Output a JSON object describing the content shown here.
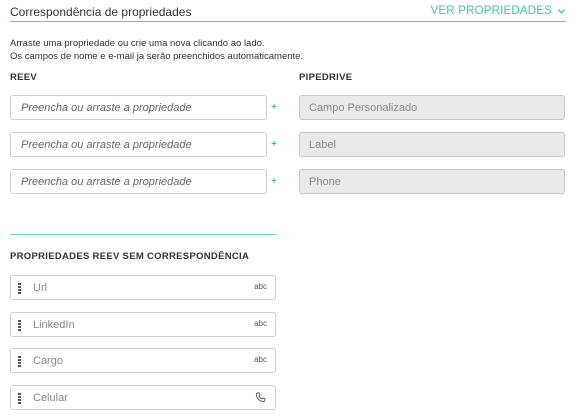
{
  "header": {
    "title": "Correspondência de propriedades",
    "toggle_label": "VER PROPRIEDADES"
  },
  "description": {
    "line1": "Arraste uma propriedade ou crie uma nova clicando ao lado.",
    "line2": "Os campos de nome e e-mail ja serão preenchidos automaticamente."
  },
  "columns": {
    "reev": "REEV",
    "pipedrive": "PIPEDRIVE"
  },
  "mappings": [
    {
      "placeholder": "Preencha ou arraste a propriedade",
      "pipedrive_field": "Campo Personalizado"
    },
    {
      "placeholder": "Preencha ou arraste a propriedade",
      "pipedrive_field": "Label"
    },
    {
      "placeholder": "Preencha ou arraste a propriedade",
      "pipedrive_field": "Phone"
    }
  ],
  "unmatched": {
    "title": "PROPRIEDADES REEV SEM CORRESPONDÊNCIA",
    "items": [
      {
        "label": "Url",
        "type": "abc",
        "type_icon": "text-type-icon"
      },
      {
        "label": "LinkedIn",
        "type": "abc",
        "type_icon": "text-type-icon"
      },
      {
        "label": "Cargo",
        "type": "abc",
        "type_icon": "text-type-icon"
      },
      {
        "label": "Celular",
        "type": "",
        "type_icon": "phone-icon"
      }
    ]
  },
  "colors": {
    "accent": "#3ec7a3",
    "divider": "#4fd1b4",
    "disabled_bg": "#eaeaea"
  }
}
